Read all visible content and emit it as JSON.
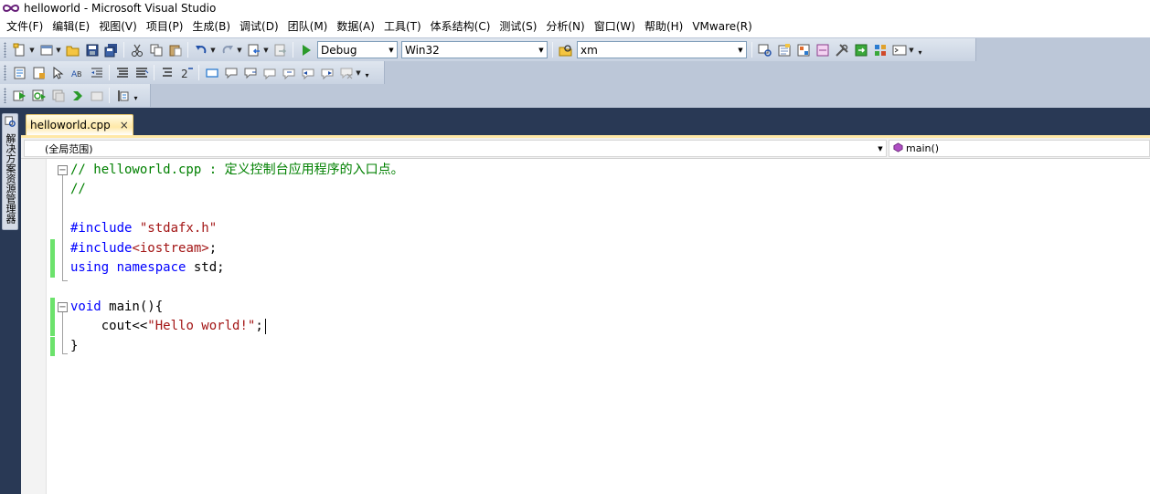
{
  "window": {
    "title": "helloworld - Microsoft Visual Studio"
  },
  "menu": {
    "items": [
      "文件(F)",
      "编辑(E)",
      "视图(V)",
      "项目(P)",
      "生成(B)",
      "调试(D)",
      "团队(M)",
      "数据(A)",
      "工具(T)",
      "体系结构(C)",
      "测试(S)",
      "分析(N)",
      "窗口(W)",
      "帮助(H)",
      "VMware(R)"
    ]
  },
  "toolbar": {
    "config_combo": "Debug",
    "platform_combo": "Win32",
    "find_combo": "xm"
  },
  "left_panel": {
    "tab_label": "解决方案资源管理器"
  },
  "tabs": {
    "active_label": "helloworld.cpp",
    "close_glyph": "×"
  },
  "navbar": {
    "scope": "(全局范围)",
    "member": "main()"
  },
  "editor": {
    "lines": [
      {
        "parts": [
          {
            "t": "// helloworld.cpp : 定义控制台应用程序的入口点。",
            "c": "cm"
          }
        ],
        "fold": "start"
      },
      {
        "parts": [
          {
            "t": "//",
            "c": "cm"
          }
        ]
      },
      {
        "parts": []
      },
      {
        "parts": [
          {
            "t": "#include ",
            "c": "pp"
          },
          {
            "t": "\"stdafx.h\"",
            "c": "str"
          }
        ]
      },
      {
        "parts": [
          {
            "t": "#include",
            "c": "pp"
          },
          {
            "t": "<iostream>",
            "c": "str"
          },
          {
            "t": ";",
            "c": "plain"
          }
        ],
        "changed": true
      },
      {
        "parts": [
          {
            "t": "using",
            "c": "kw"
          },
          {
            "t": " ",
            "c": "plain"
          },
          {
            "t": "namespace",
            "c": "kw"
          },
          {
            "t": " std;",
            "c": "plain"
          }
        ],
        "changed": true
      },
      {
        "parts": []
      },
      {
        "parts": [
          {
            "t": "void",
            "c": "kw"
          },
          {
            "t": " main(){",
            "c": "plain"
          }
        ],
        "fold": "start",
        "changed": true
      },
      {
        "parts": [
          {
            "t": "    cout<<",
            "c": "plain"
          },
          {
            "t": "\"Hello world!\"",
            "c": "str"
          },
          {
            "t": ";",
            "c": "plain"
          }
        ],
        "changed": true,
        "caret": true
      },
      {
        "parts": [
          {
            "t": "}",
            "c": "plain"
          }
        ],
        "changed": true,
        "fold": "end"
      }
    ]
  },
  "colors": {
    "dock_background": "#293955",
    "toolbar_background": "#bcc7d8",
    "active_tab": "#ffe8a6",
    "change_marker": "#6ce26c",
    "keyword": "#0000ff",
    "comment": "#008000",
    "string": "#a31515"
  }
}
